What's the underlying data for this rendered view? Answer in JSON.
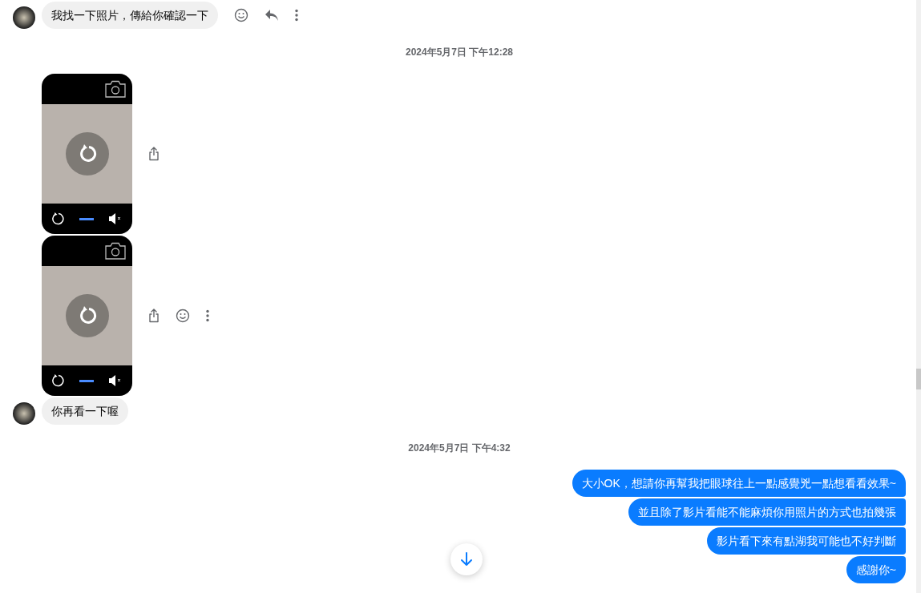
{
  "messages": [
    {
      "kind": "incoming_text",
      "text": "我找一下照片，傳給你確認一下",
      "avatar": true,
      "actions": [
        {
          "kind": "react"
        },
        {
          "kind": "reply"
        },
        {
          "kind": "more"
        }
      ]
    },
    {
      "kind": "timestamp",
      "text": "2024年5月7日 下午12:28"
    },
    {
      "kind": "video",
      "avatar": false,
      "actions": [
        {
          "kind": "share"
        }
      ]
    },
    {
      "kind": "video",
      "avatar": false,
      "actions": [
        {
          "kind": "share"
        },
        {
          "kind": "react"
        },
        {
          "kind": "more"
        }
      ]
    },
    {
      "kind": "incoming_text",
      "text": "你再看一下喔",
      "avatar": true
    },
    {
      "kind": "timestamp",
      "text": "2024年5月7日 下午4:32"
    },
    {
      "kind": "outgoing_text",
      "text": "大小OK，想請你再幫我把眼球往上一點感覺兇一點想看看效果~"
    },
    {
      "kind": "outgoing_text",
      "text": "並且除了影片看能不能麻煩你用照片的方式也拍幾張"
    },
    {
      "kind": "outgoing_text",
      "text": "影片看下來有點湖我可能也不好判斷"
    },
    {
      "kind": "outgoing_text",
      "text": "感謝你~"
    }
  ]
}
